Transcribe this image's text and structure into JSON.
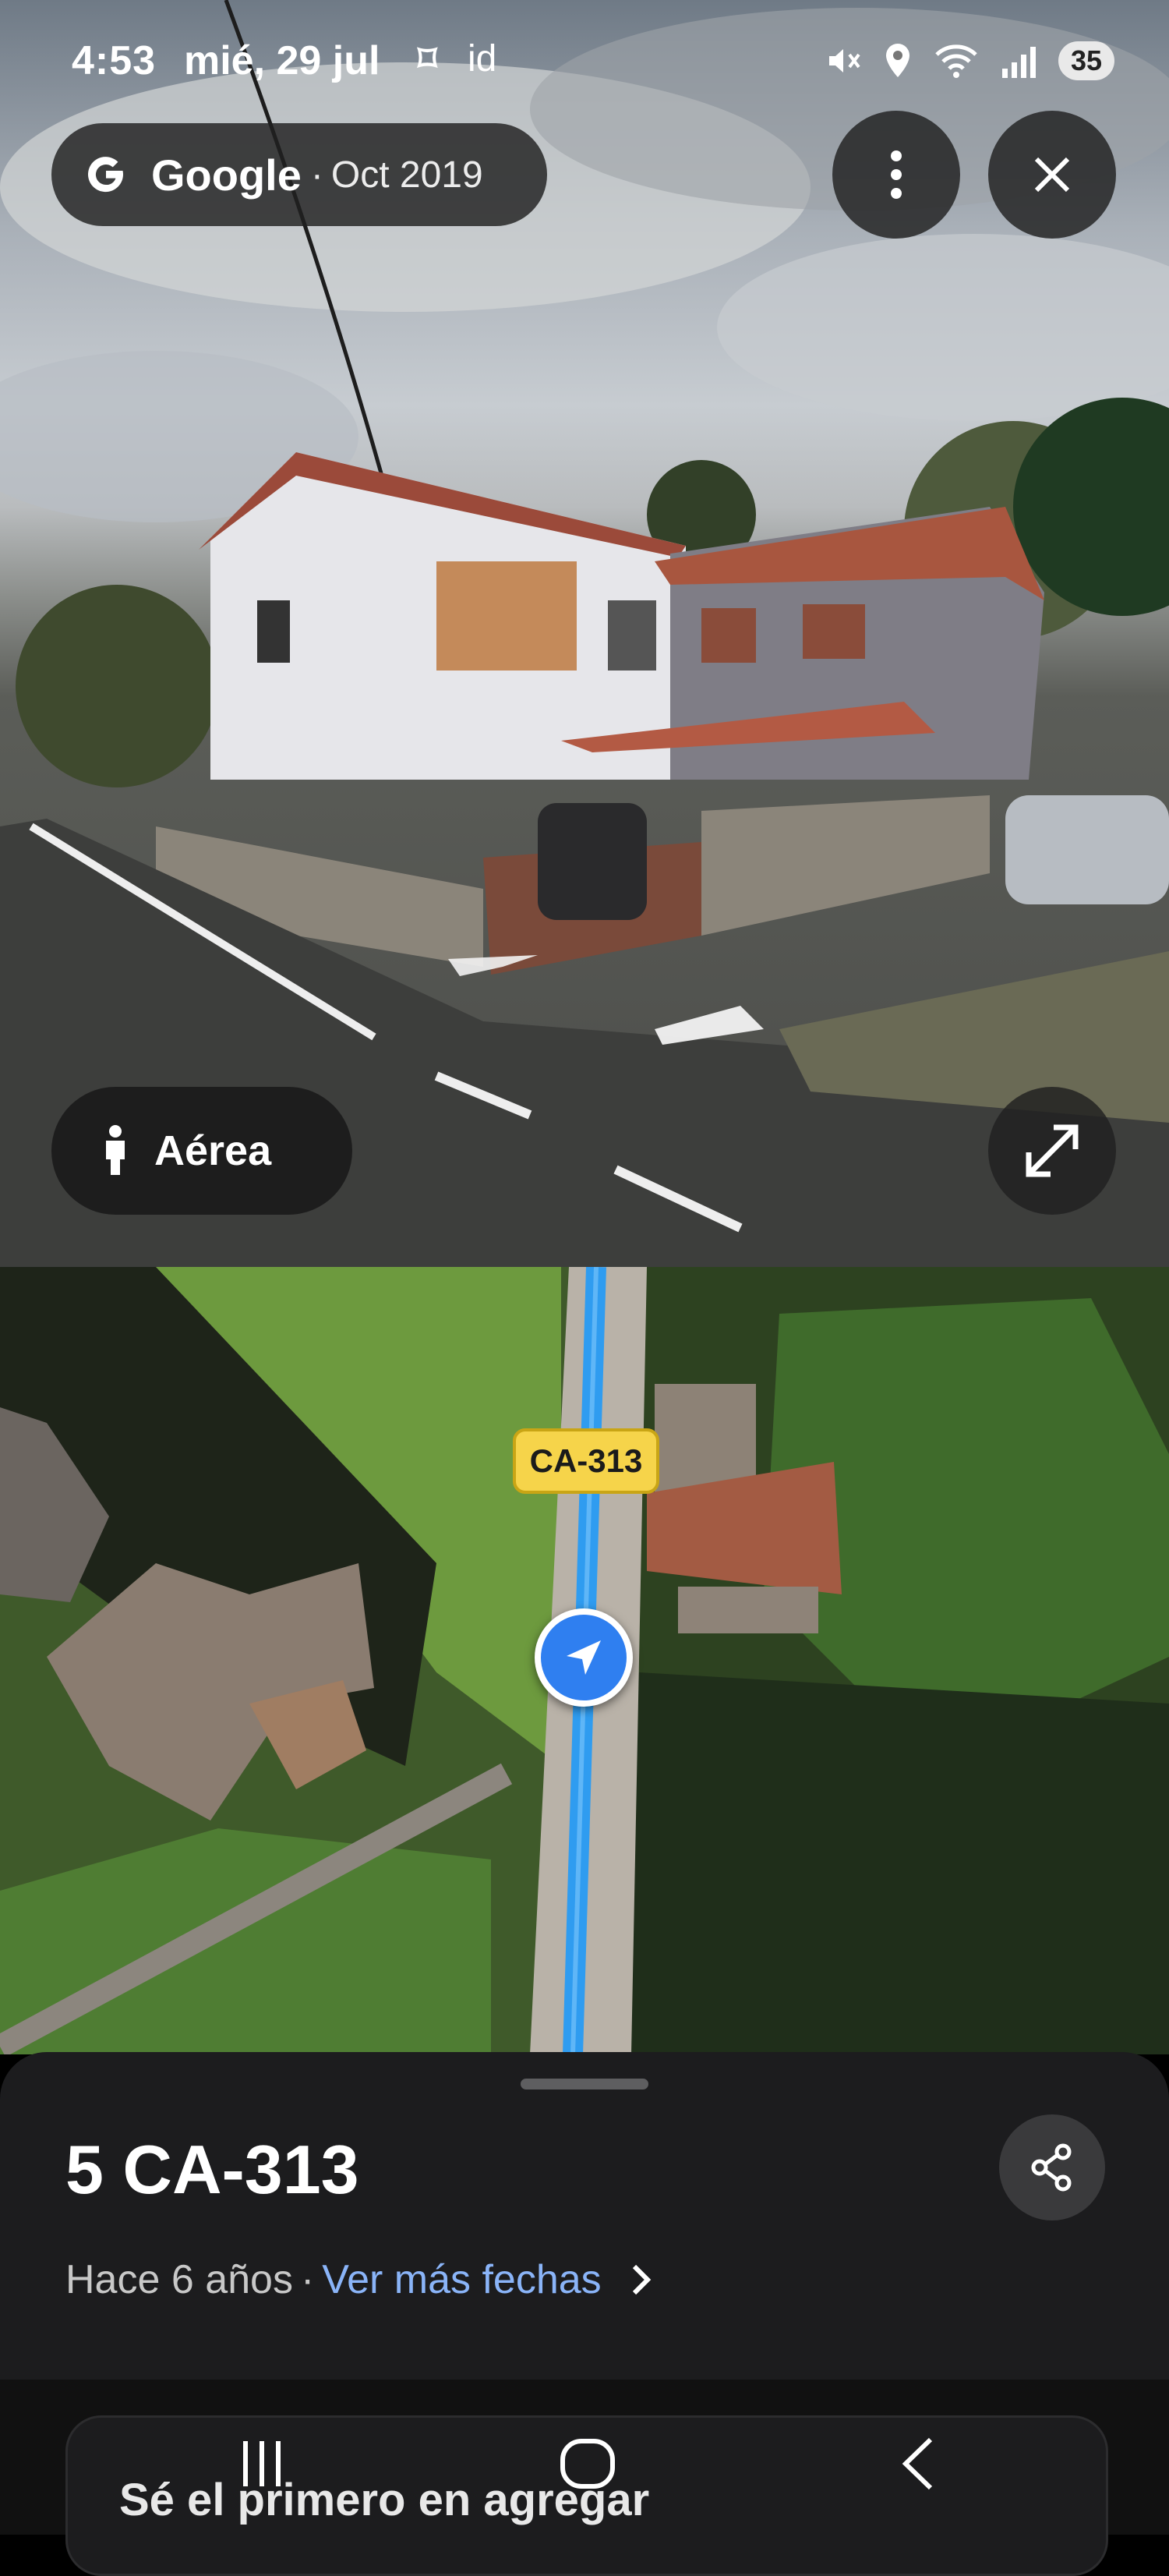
{
  "status_bar": {
    "time": "4:53",
    "date": "mié, 29 jul",
    "extra": "id",
    "battery": "35"
  },
  "imagery": {
    "brand": "Google",
    "separator": "·",
    "date": "Oct 2019"
  },
  "controls": {
    "aerial_label": "Aérea"
  },
  "map": {
    "road_badge": "CA-313"
  },
  "place": {
    "title": "5 CA-313",
    "age": "Hace 6 años",
    "separator": "·",
    "more_dates_link": "Ver más fechas"
  },
  "contribution": {
    "prompt": "Sé el primero en agregar"
  },
  "colors": {
    "link": "#8ab4f8",
    "route": "#2f9cf0",
    "badge": "#f6d44a",
    "sheet": "#1c1c1e"
  },
  "icons": [
    "google-g-icon",
    "more-vert-icon",
    "close-icon",
    "pedestrian-icon",
    "expand-icon",
    "navigation-arrow-icon",
    "share-icon",
    "chevron-right-icon",
    "recents-icon",
    "home-icon",
    "back-icon"
  ]
}
